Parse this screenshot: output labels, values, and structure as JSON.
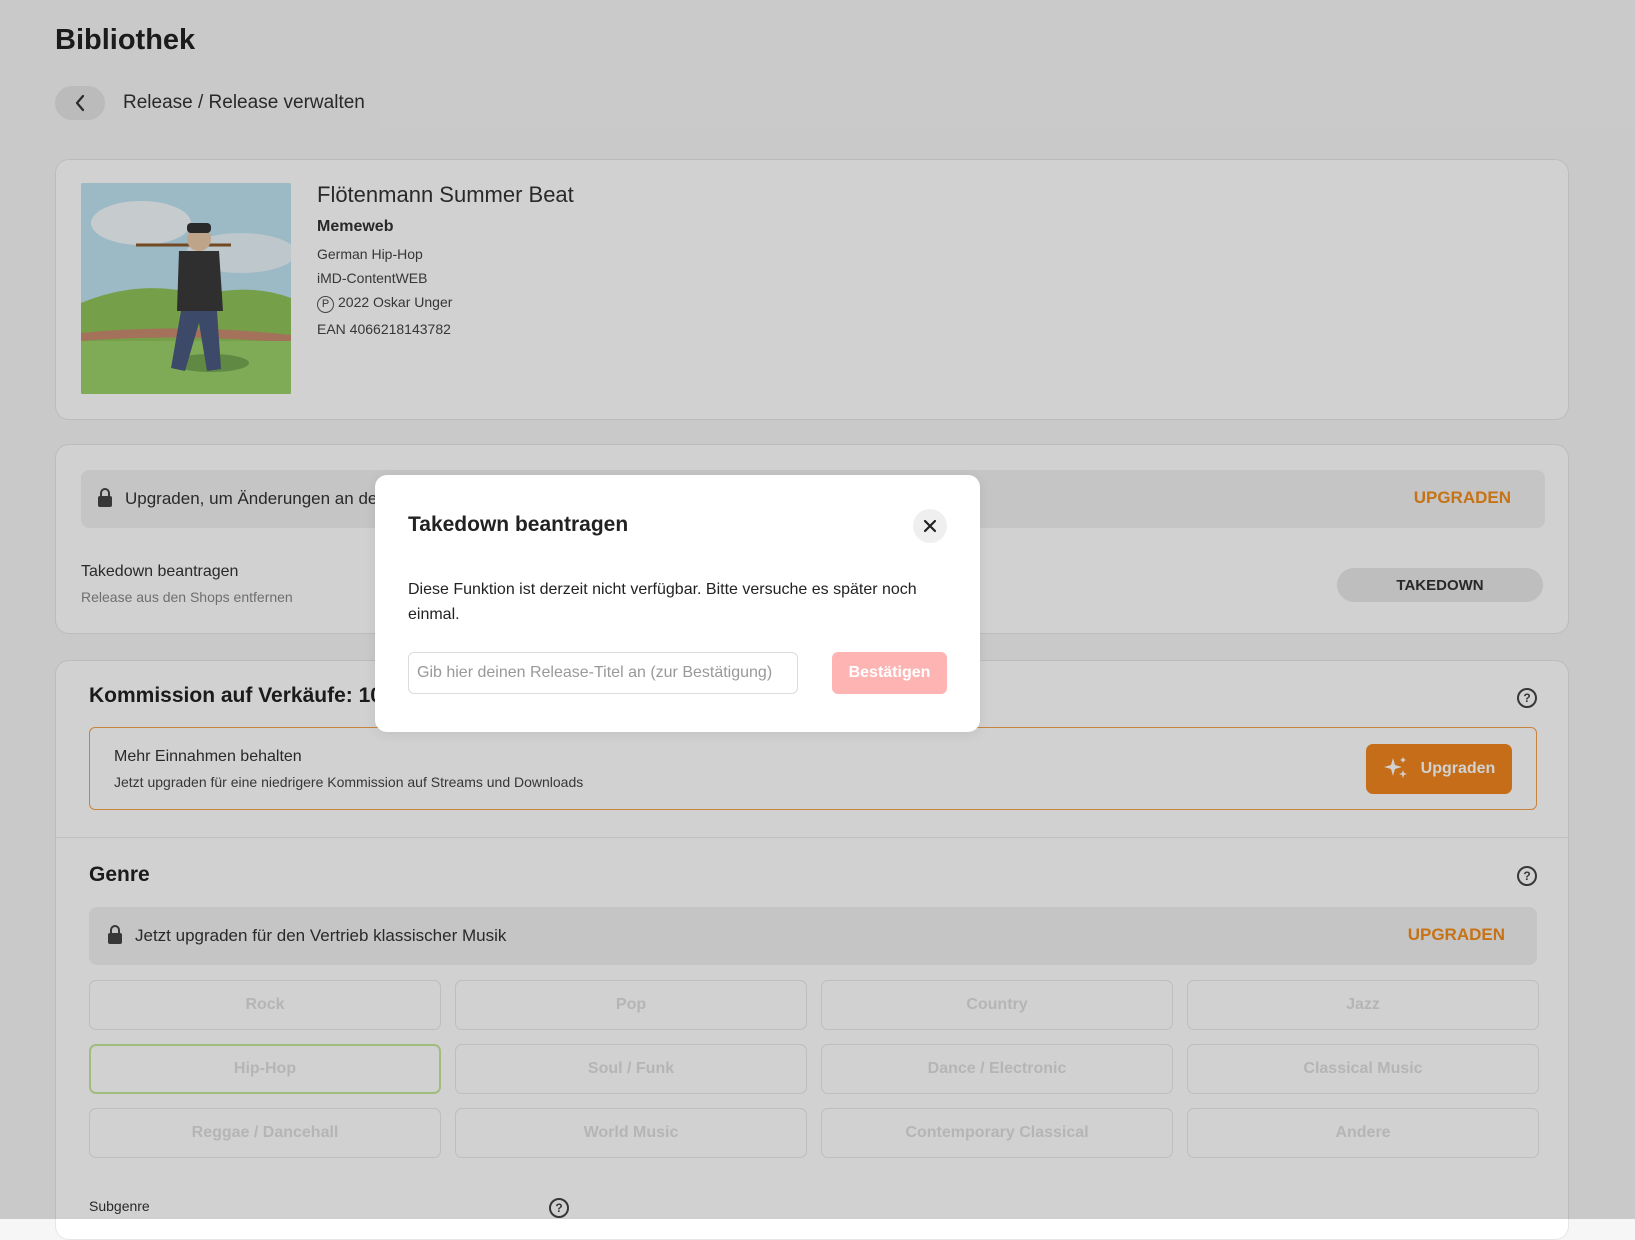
{
  "page": {
    "title": "Bibliothek",
    "breadcrumb": "Release / Release verwalten"
  },
  "release": {
    "title": "Flötenmann Summer Beat",
    "artist": "Memeweb",
    "genre": "German Hip-Hop",
    "label": "iMD-ContentWEB",
    "p_symbol": "P",
    "copyright": "2022 Oskar Unger",
    "ean": "EAN 4066218143782"
  },
  "changes": {
    "lock_text": "Upgraden, um Änderungen an de",
    "upgrade_label": "UPGRADEN",
    "takedown_title": "Takedown beantragen",
    "takedown_sub": "Release aus den Shops entfernen",
    "takedown_button": "TAKEDOWN"
  },
  "commission": {
    "title": "Kommission auf Verkäufe: 10",
    "help": "?",
    "promo_heading": "Mehr Einnahmen behalten",
    "promo_text": "Jetzt upgraden für eine niedrigere Kommission auf Streams und Downloads",
    "promo_button": "Upgraden"
  },
  "genre": {
    "title": "Genre",
    "help": "?",
    "lock_text": "Jetzt upgraden für den Vertrieb klassischer Musik",
    "upgrade_label": "UPGRADEN",
    "options": [
      "Rock",
      "Pop",
      "Country",
      "Jazz",
      "Hip-Hop",
      "Soul / Funk",
      "Dance / Electronic",
      "Classical Music",
      "Reggae / Dancehall",
      "World Music",
      "Contemporary Classical",
      "Andere"
    ],
    "selected": "Hip-Hop",
    "subgenre_label": "Subgenre"
  },
  "modal": {
    "title": "Takedown beantragen",
    "message": "Diese Funktion ist derzeit nicht verfügbar. Bitte versuche es später noch einmal.",
    "input_placeholder": "Gib hier deinen Release-Titel an (zur Bestätigung)",
    "confirm_label": "Bestätigen"
  },
  "colors": {
    "accent": "#f1861e",
    "confirm_disabled": "#ffb4b4",
    "selected_border": "#c5e79a"
  }
}
